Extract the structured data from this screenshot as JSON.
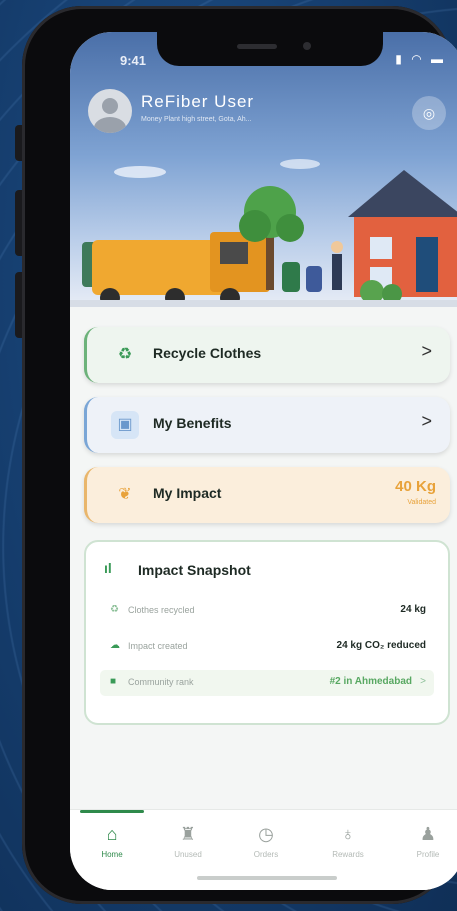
{
  "status": {
    "time": "9:41"
  },
  "user": {
    "name": "ReFiber User",
    "address": "Money Plant high street, Gota, Ah..."
  },
  "menu": [
    {
      "label": "Recycle Clothes",
      "icon": "recycle-icon"
    },
    {
      "label": "My Benefits",
      "icon": "gift-icon"
    },
    {
      "label": "My Impact",
      "icon": "leaf-icon",
      "value": "40 Kg",
      "sub": "Validated"
    }
  ],
  "snapshot": {
    "title": "Impact Snapshot",
    "rows": [
      {
        "label": "Clothes recycled",
        "value": "24 kg"
      },
      {
        "label": "Impact created",
        "value": "24 kg CO₂ reduced"
      },
      {
        "label": "Community rank",
        "value": "#2 in Ahmedabad"
      }
    ]
  },
  "nav": {
    "tabs": [
      {
        "label": "Home",
        "icon": "home-icon"
      },
      {
        "label": "Unused",
        "icon": "shirt-icon"
      },
      {
        "label": "Orders",
        "icon": "clock-icon"
      },
      {
        "label": "Rewards",
        "icon": "medal-icon"
      },
      {
        "label": "Profile",
        "icon": "user-icon"
      }
    ]
  },
  "colors": {
    "accent": "#2f8a4b",
    "background": "#163f70",
    "impact": "#e8a23a"
  }
}
